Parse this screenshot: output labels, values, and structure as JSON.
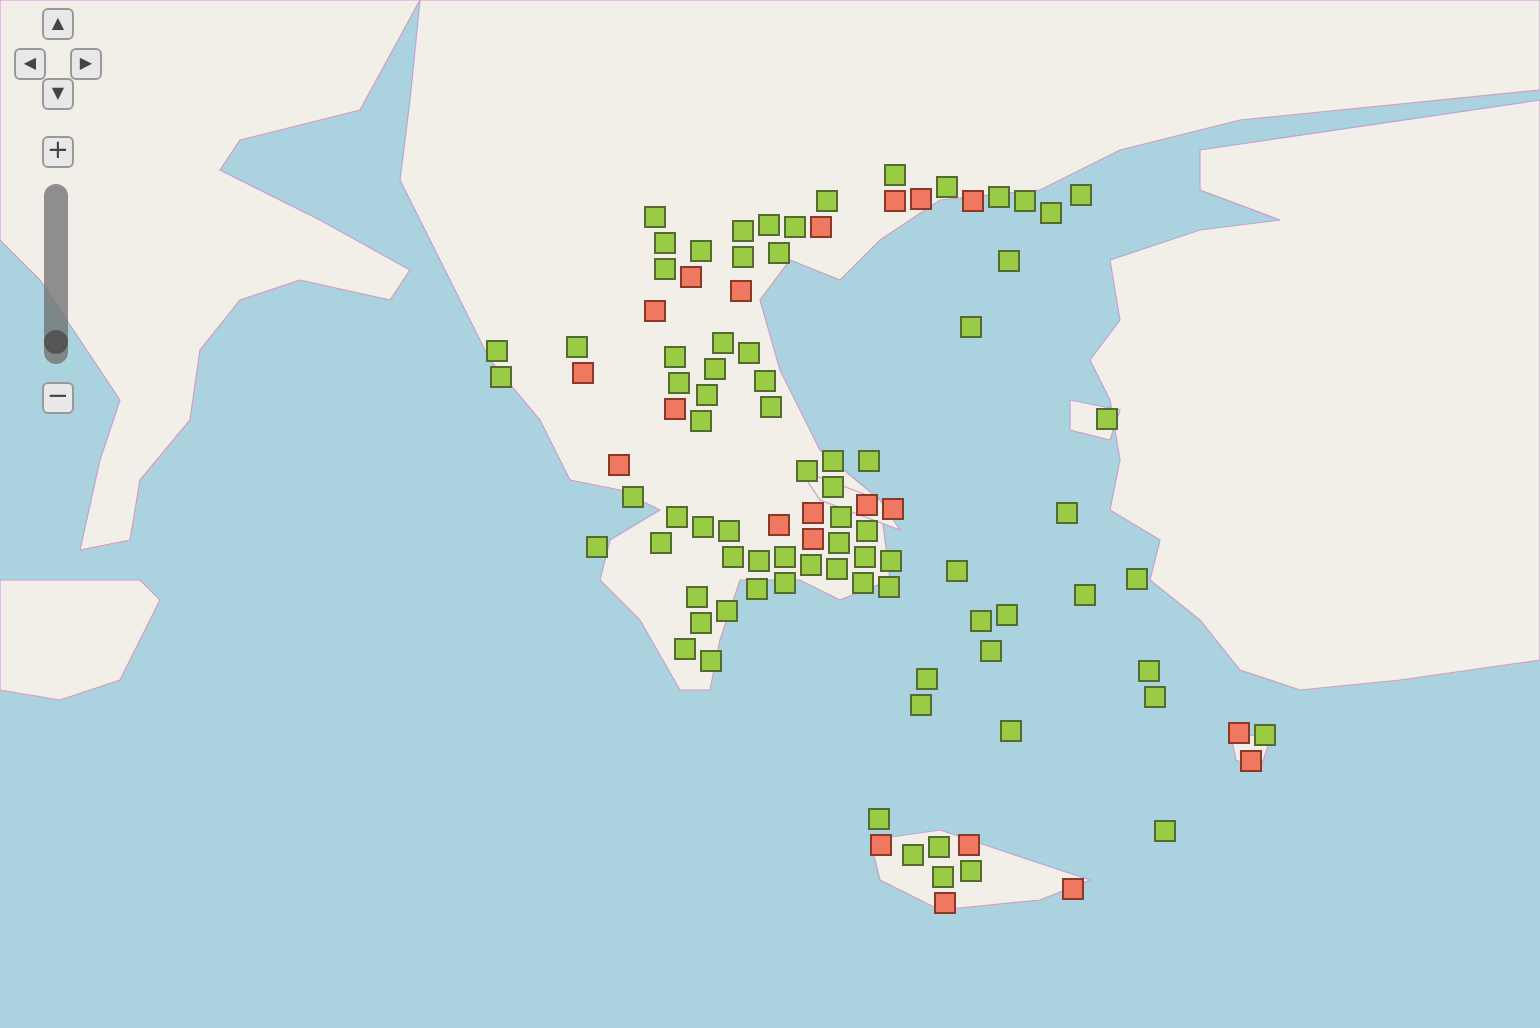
{
  "map": {
    "pan_controls": [
      {
        "kind": "up",
        "glyph": "▲"
      },
      {
        "kind": "left",
        "glyph": "◀"
      },
      {
        "kind": "right",
        "glyph": "▶"
      },
      {
        "kind": "down",
        "glyph": "▼"
      }
    ],
    "zoom_in": "+",
    "zoom_slider": {
      "level": 0.07
    },
    "zoom_out": "−",
    "markers": [
      {
        "color": "#99cc44"
      },
      {
        "color": "#99cc44"
      },
      {
        "color": "#f07860"
      },
      {
        "color": "#99cc44"
      },
      {
        "color": "#f07860"
      },
      {
        "color": "#99cc44"
      },
      {
        "color": "#f07860"
      },
      {
        "color": "#99cc44"
      },
      {
        "color": "#99cc44"
      },
      {
        "color": "#99cc44"
      },
      {
        "color": "#99cc44"
      },
      {
        "color": "#99cc44"
      },
      {
        "color": "#f07860"
      },
      {
        "color": "#99cc44"
      },
      {
        "color": "#99cc44"
      },
      {
        "color": "#f07860"
      },
      {
        "color": "#f07860"
      },
      {
        "color": "#99cc44"
      },
      {
        "color": "#f07860"
      },
      {
        "color": "#99cc44"
      },
      {
        "color": "#99cc44"
      },
      {
        "color": "#99cc44"
      },
      {
        "color": "#99cc44"
      },
      {
        "color": "#99cc44"
      },
      {
        "color": "#99cc44"
      },
      {
        "color": "#99cc44"
      },
      {
        "color": "#99cc44"
      },
      {
        "color": "#99cc44"
      },
      {
        "color": "#99cc44"
      },
      {
        "color": "#f07860"
      },
      {
        "color": "#99cc44"
      },
      {
        "color": "#99cc44"
      },
      {
        "color": "#99cc44"
      },
      {
        "color": "#99cc44"
      },
      {
        "color": "#f07860"
      },
      {
        "color": "#99cc44"
      },
      {
        "color": "#99cc44"
      },
      {
        "color": "#99cc44"
      },
      {
        "color": "#99cc44"
      },
      {
        "color": "#99cc44"
      },
      {
        "color": "#99cc44"
      },
      {
        "color": "#f07860"
      },
      {
        "color": "#99cc44"
      },
      {
        "color": "#99cc44"
      },
      {
        "color": "#f07860"
      },
      {
        "color": "#99cc44"
      },
      {
        "color": "#99cc44"
      },
      {
        "color": "#99cc44"
      },
      {
        "color": "#99cc44"
      },
      {
        "color": "#99cc44"
      },
      {
        "color": "#99cc44"
      },
      {
        "color": "#99cc44"
      },
      {
        "color": "#99cc44"
      },
      {
        "color": "#f07860"
      },
      {
        "color": "#99cc44"
      },
      {
        "color": "#99cc44"
      },
      {
        "color": "#99cc44"
      },
      {
        "color": "#99cc44"
      },
      {
        "color": "#99cc44"
      },
      {
        "color": "#f07860"
      },
      {
        "color": "#99cc44"
      },
      {
        "color": "#99cc44"
      },
      {
        "color": "#99cc44"
      },
      {
        "color": "#99cc44"
      },
      {
        "color": "#99cc44"
      },
      {
        "color": "#99cc44"
      },
      {
        "color": "#99cc44"
      },
      {
        "color": "#99cc44"
      },
      {
        "color": "#99cc44"
      },
      {
        "color": "#99cc44"
      },
      {
        "color": "#99cc44"
      },
      {
        "color": "#f07860"
      },
      {
        "color": "#99cc44"
      },
      {
        "color": "#99cc44"
      },
      {
        "color": "#99cc44"
      },
      {
        "color": "#99cc44"
      },
      {
        "color": "#99cc44"
      },
      {
        "color": "#99cc44"
      },
      {
        "color": "#99cc44"
      },
      {
        "color": "#99cc44"
      },
      {
        "color": "#99cc44"
      },
      {
        "color": "#99cc44"
      },
      {
        "color": "#99cc44"
      },
      {
        "color": "#99cc44"
      },
      {
        "color": "#99cc44"
      },
      {
        "color": "#f07860"
      },
      {
        "color": "#f07860"
      },
      {
        "color": "#99cc44"
      },
      {
        "color": "#99cc44"
      },
      {
        "color": "#f07860"
      },
      {
        "color": "#99cc44"
      },
      {
        "color": "#99cc44"
      },
      {
        "color": "#f07860"
      },
      {
        "color": "#99cc44"
      },
      {
        "color": "#99cc44"
      },
      {
        "color": "#99cc44"
      },
      {
        "color": "#f07860"
      },
      {
        "color": "#f07860"
      },
      {
        "color": "#99cc44"
      },
      {
        "color": "#f07860"
      }
    ]
  }
}
